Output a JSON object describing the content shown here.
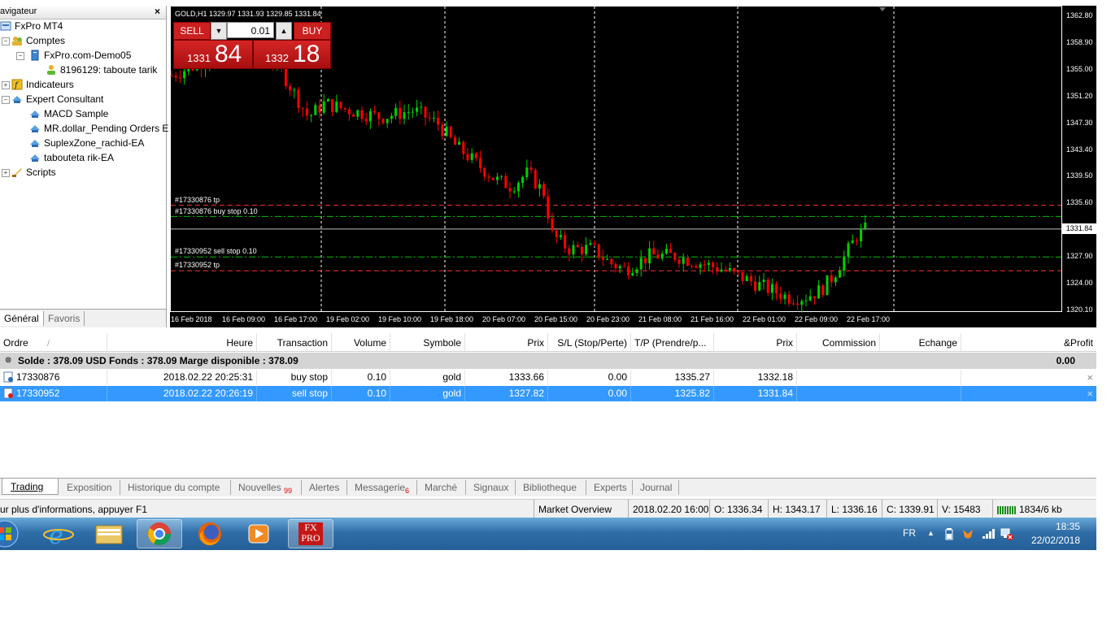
{
  "navigator": {
    "title": "avigateur",
    "close": "×",
    "items": [
      {
        "label": "FxPro MT4",
        "icon": "terminal-icon"
      },
      {
        "label": "Comptes",
        "icon": "accounts-icon"
      },
      {
        "label": "FxPro.com-Demo05",
        "icon": "server-icon"
      },
      {
        "label": "8196129: taboute tarik",
        "icon": "user-icon"
      },
      {
        "label": "Indicateurs",
        "icon": "indicator-icon"
      },
      {
        "label": "Expert Consultant",
        "icon": "expert-icon"
      },
      {
        "label": "MACD Sample",
        "icon": "ea-icon"
      },
      {
        "label": "MR.dollar_Pending Orders E",
        "icon": "ea-icon"
      },
      {
        "label": "SuplexZone_rachid-EA",
        "icon": "ea-icon"
      },
      {
        "label": "tabouteta rik-EA",
        "icon": "ea-icon"
      },
      {
        "label": "Scripts",
        "icon": "script-icon"
      }
    ],
    "tabs": [
      "Général",
      "Favoris"
    ]
  },
  "chart": {
    "symbol_line": "GOLD,H1  1329.97 1331.93 1329.85 1331.84",
    "one_click": {
      "sell": "SELL",
      "buy": "BUY",
      "lot": "0.01",
      "bid_small": "1331",
      "bid_big": "84",
      "ask_small": "1332",
      "ask_big": "18"
    },
    "order_labels": [
      {
        "text": "#17330876 tp",
        "price": 1335.27,
        "style": "tp"
      },
      {
        "text": "#17330876 buy stop 0.10",
        "price": 1333.66,
        "style": "stop"
      },
      {
        "text": "#17330952 sell stop 0.10",
        "price": 1327.82,
        "style": "stop"
      },
      {
        "text": "#17330952 tp",
        "price": 1325.82,
        "style": "tp"
      }
    ],
    "current_price": "1331.84",
    "y_ticks": [
      "1362.80",
      "1358.90",
      "1355.00",
      "1351.20",
      "1347.30",
      "1343.40",
      "1339.50",
      "1335.60",
      "1327.90",
      "1324.00",
      "1320.10"
    ],
    "x_ticks": [
      "16 Feb 2018",
      "16 Feb 09:00",
      "16 Feb 17:00",
      "19 Feb 02:00",
      "19 Feb 10:00",
      "19 Feb 18:00",
      "20 Feb 07:00",
      "20 Feb 15:00",
      "20 Feb 23:00",
      "21 Feb 08:00",
      "21 Feb 16:00",
      "22 Feb 01:00",
      "22 Feb 09:00",
      "22 Feb 17:00"
    ],
    "colors": {
      "bull": "#00d000",
      "bear": "#ff0000",
      "tp": "#ff3030",
      "stop": "#00c000",
      "bg": "#000000"
    }
  },
  "terminal": {
    "headers": [
      "Ordre",
      "/",
      "Heure",
      "Transaction",
      "Volume",
      "Symbole",
      "Prix",
      "S/L (Stop/Perte)",
      "T/P (Prendre/p...",
      "Prix",
      "Commission",
      "Echange",
      "&Profit"
    ],
    "balance": "Solde : 378.09 USD  Fonds : 378.09  Marge disponible : 378.09",
    "balance_profit": "0.00",
    "rows": [
      {
        "order": "17330876",
        "time": "2018.02.22 20:25:31",
        "type": "buy stop",
        "volume": "0.10",
        "symbol": "gold",
        "price": "1333.66",
        "sl": "0.00",
        "tp": "1335.27",
        "cur": "1332.18",
        "close": "×"
      },
      {
        "order": "17330952",
        "time": "2018.02.22 20:26:19",
        "type": "sell stop",
        "volume": "0.10",
        "symbol": "gold",
        "price": "1327.82",
        "sl": "0.00",
        "tp": "1325.82",
        "cur": "1331.84",
        "close": "×"
      }
    ],
    "tabs": [
      {
        "label": "Trading"
      },
      {
        "label": "Exposition"
      },
      {
        "label": "Historique du compte"
      },
      {
        "label": "Nouvelles",
        "badge": "99"
      },
      {
        "label": "Alertes"
      },
      {
        "label": "Messagerie",
        "badge": "6"
      },
      {
        "label": "Marché"
      },
      {
        "label": "Signaux"
      },
      {
        "label": "Bibliotheque"
      },
      {
        "label": "Experts"
      },
      {
        "label": "Journal"
      }
    ]
  },
  "status": {
    "help": "ur plus d'informations, appuyer F1",
    "profile": "Market Overview",
    "datetime": "2018.02.20 16:00",
    "open": "O: 1336.34",
    "high": "H: 1343.17",
    "low": "L: 1336.16",
    "close": "C: 1339.91",
    "volume": "V: 15483",
    "traffic": "1834/6 kb"
  },
  "taskbar": {
    "lang": "FR",
    "time": "18:35",
    "date": "22/02/2018",
    "apps": [
      "start-orb",
      "ie-icon",
      "explorer-icon",
      "chrome-icon",
      "firefox-icon",
      "media-icon",
      "fxpro-icon"
    ],
    "fxpro_label": "FX PRO"
  }
}
